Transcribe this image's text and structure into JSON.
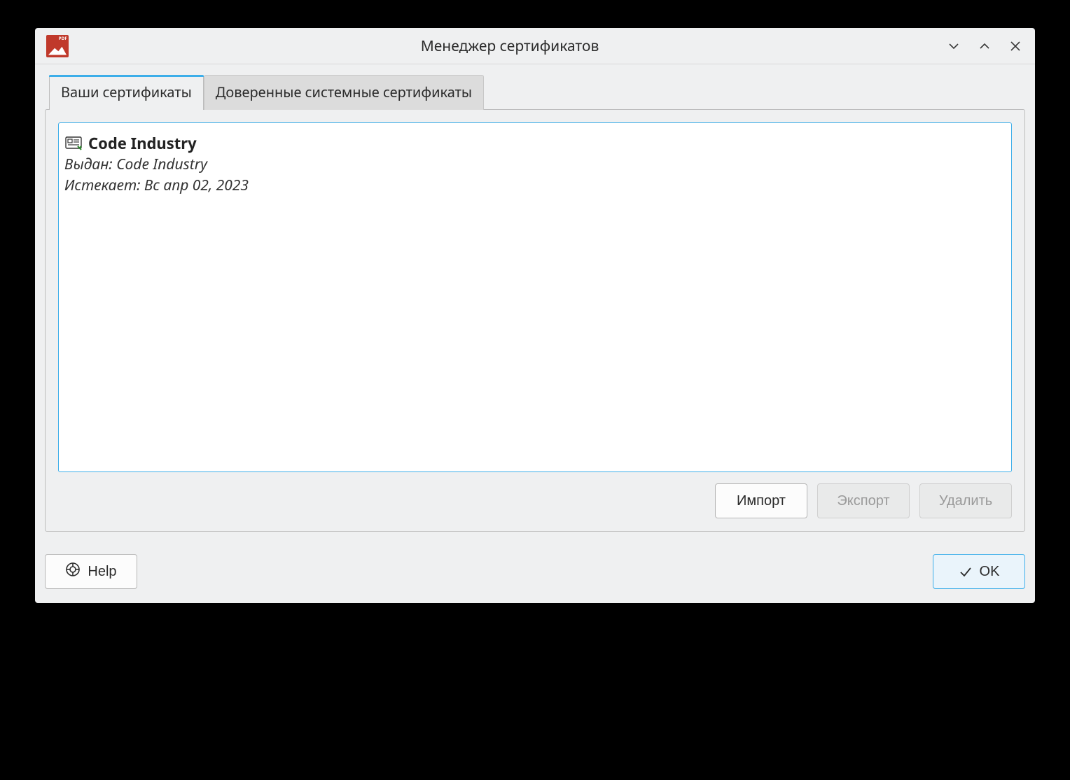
{
  "window": {
    "title": "Менеджер сертификатов"
  },
  "tabs": {
    "your_certs": "Ваши сертификаты",
    "trusted_certs": "Доверенные системные сертификаты"
  },
  "certificate": {
    "name": "Code Industry",
    "issued_label": "Выдан:",
    "issued_value": "Code Industry",
    "expires_label": "Истекает:",
    "expires_value": "Вс апр 02, 2023"
  },
  "buttons": {
    "import": "Импорт",
    "export": "Экспорт",
    "delete": "Удалить",
    "help": "Help",
    "ok": "OK"
  }
}
